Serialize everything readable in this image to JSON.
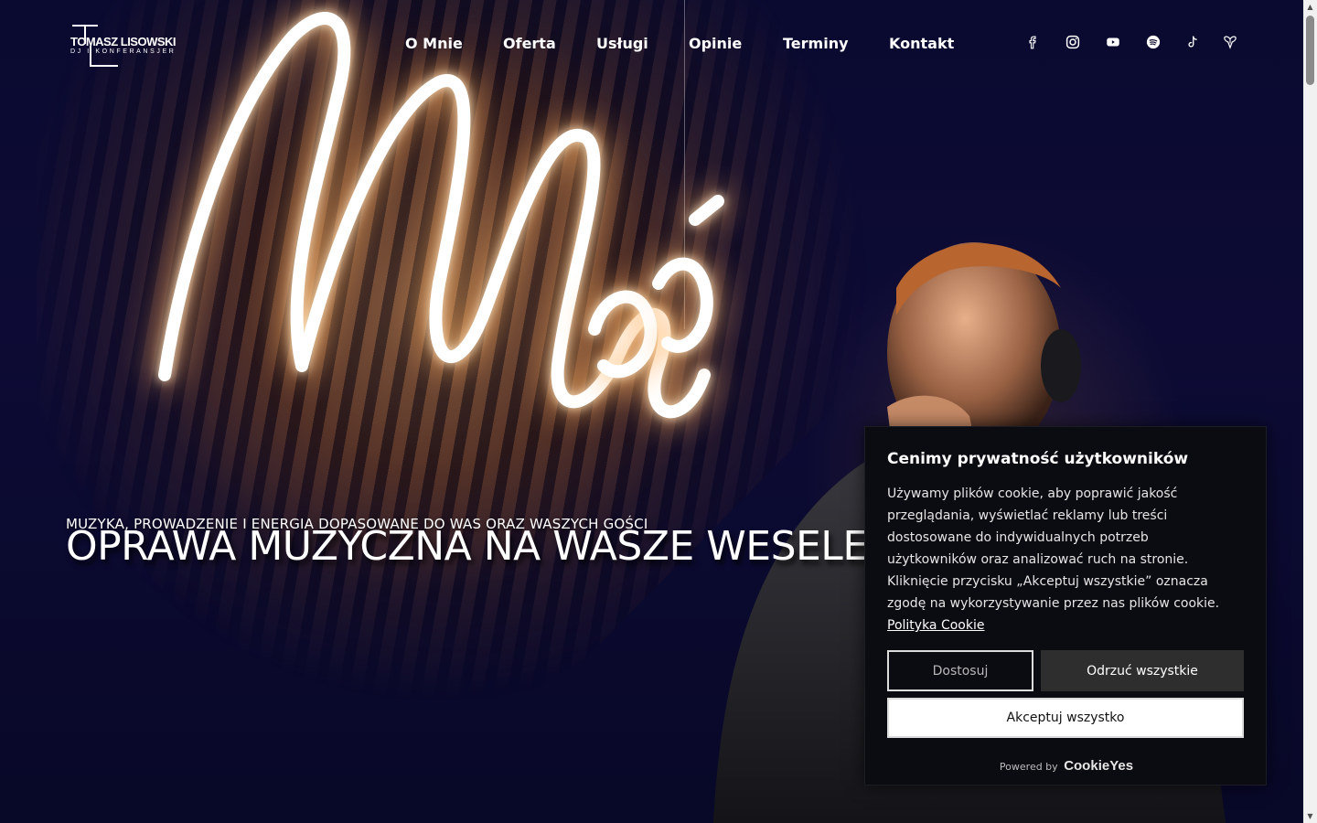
{
  "brand": {
    "name": "TOMASZ LISOWSKI",
    "tagline": "DJ I KONFERANSJER"
  },
  "nav": {
    "items": [
      {
        "label": "O Mnie"
      },
      {
        "label": "Oferta"
      },
      {
        "label": "Usługi"
      },
      {
        "label": "Opinie"
      },
      {
        "label": "Terminy"
      },
      {
        "label": "Kontakt"
      }
    ]
  },
  "social": {
    "icons": [
      "facebook-icon",
      "instagram-icon",
      "youtube-icon",
      "spotify-icon",
      "tiktok-icon",
      "wedding-portal-icon"
    ]
  },
  "hero": {
    "subtitle": "MUZYKA, PROWADZENIE I ENERGIA DOPASOWANE DO WAS ORAZ WASZYCH GOŚCI",
    "title": "OPRAWA MUZYCZNA NA WASZE WESELE"
  },
  "cookie": {
    "title": "Cenimy prywatność użytkowników",
    "text": "Używamy plików cookie, aby poprawić jakość przeglądania, wyświetlać reklamy lub treści dostosowane do indywidualnych potrzeb użytkowników oraz analizować ruch na stronie. Kliknięcie przycisku „Akceptuj wszystkie” oznacza zgodę na wykorzystywanie przez nas plików cookie.",
    "policy_link": "Polityka Cookie",
    "customize_label": "Dostosuj",
    "reject_label": "Odrzuć wszystkie",
    "accept_label": "Akceptuj wszystko",
    "powered_by": "Powered by",
    "powered_brand": "CookieYes"
  },
  "colors": {
    "background": "#07072a",
    "cookie_bg": "#0b0b12",
    "reject_bg": "#2e2e2e",
    "accept_bg": "#ffffff"
  }
}
